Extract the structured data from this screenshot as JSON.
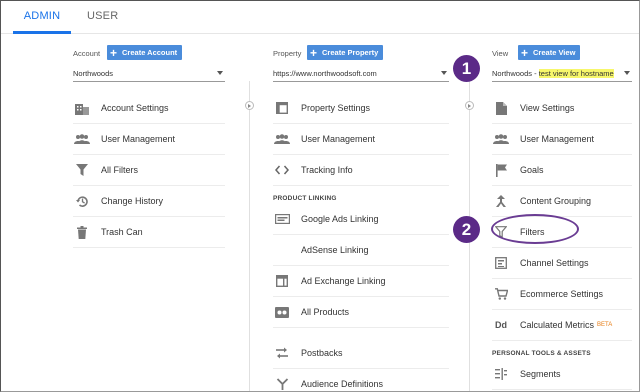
{
  "tabs": {
    "admin": "ADMIN",
    "user": "USER"
  },
  "account": {
    "title": "Account",
    "create_label": "Create Account",
    "selected": "Northwoods",
    "items": [
      {
        "label": "Account Settings",
        "icon": "building-icon"
      },
      {
        "label": "User Management",
        "icon": "users-icon"
      },
      {
        "label": "All Filters",
        "icon": "filter-icon"
      },
      {
        "label": "Change History",
        "icon": "history-icon"
      },
      {
        "label": "Trash Can",
        "icon": "trash-icon"
      }
    ]
  },
  "property": {
    "title": "Property",
    "create_label": "Create Property",
    "selected": "https://www.northwoodsoft.com",
    "items": [
      {
        "label": "Property Settings",
        "icon": "window-icon"
      },
      {
        "label": "User Management",
        "icon": "users-icon"
      },
      {
        "label": "Tracking Info",
        "icon": "code-icon"
      }
    ],
    "product_linking_header": "PRODUCT LINKING",
    "linking_items": [
      {
        "label": "Google Ads Linking",
        "icon": "ads-icon"
      },
      {
        "label": "AdSense Linking",
        "icon": "none"
      },
      {
        "label": "Ad Exchange Linking",
        "icon": "ad-exchange-icon"
      },
      {
        "label": "All Products",
        "icon": "all-products-icon"
      }
    ],
    "more_items": [
      {
        "label": "Postbacks",
        "icon": "postbacks-icon"
      },
      {
        "label": "Audience Definitions",
        "icon": "audience-icon"
      }
    ]
  },
  "view": {
    "title": "View",
    "create_label": "Create View",
    "selected_prefix": "Northwoods - ",
    "selected_highlight": "test view for hostname",
    "items": [
      {
        "label": "View Settings",
        "icon": "document-icon"
      },
      {
        "label": "User Management",
        "icon": "users-icon"
      },
      {
        "label": "Goals",
        "icon": "flag-icon"
      },
      {
        "label": "Content Grouping",
        "icon": "grouping-icon"
      },
      {
        "label": "Filters",
        "icon": "filter-outline-icon"
      },
      {
        "label": "Channel Settings",
        "icon": "channel-icon"
      },
      {
        "label": "Ecommerce Settings",
        "icon": "cart-icon"
      },
      {
        "label": "Calculated Metrics",
        "icon": "dd-icon",
        "badge": "BETA"
      }
    ],
    "personal_header": "PERSONAL TOOLS & ASSETS",
    "personal_items": [
      {
        "label": "Segments",
        "icon": "segments-icon"
      }
    ]
  },
  "callouts": {
    "one": "1",
    "two": "2"
  },
  "colors": {
    "accent": "#1a73e8",
    "button": "#4a8cdb",
    "callout": "#5b2a87",
    "highlight": "#f7f76b",
    "beta": "#e67c15"
  }
}
